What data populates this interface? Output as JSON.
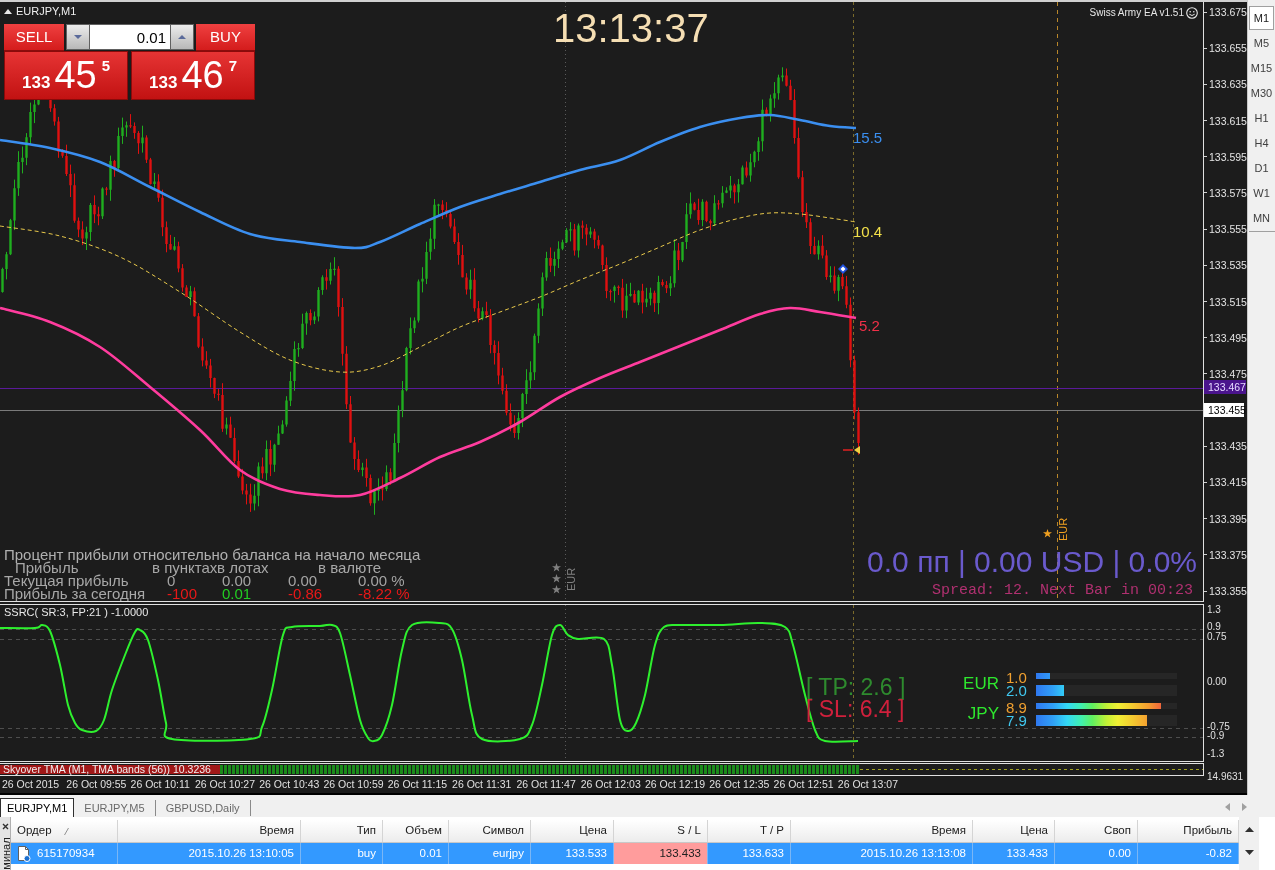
{
  "chart": {
    "title": "EURJPY,M1",
    "trade_panel": {
      "sell_label": "SELL",
      "buy_label": "BUY",
      "lot": "0.01",
      "sell_price": {
        "figure": "133",
        "pips": "45",
        "point": "5"
      },
      "buy_price": {
        "figure": "133",
        "pips": "46",
        "point": "7"
      }
    },
    "clock": "13:13:37",
    "expert_label": "Swiss Army EA v1.51",
    "ma_labels": [
      {
        "text": "15.5",
        "color": "#3b8ff0"
      },
      {
        "text": "10.4",
        "color": "#f2e04a"
      },
      {
        "text": "5.2",
        "color": "#f03048"
      }
    ],
    "profit_report": {
      "title": "Процент прибыли относительно баланса на начало месяца",
      "header": [
        "Прибыль",
        "в пунктах",
        "в лотах",
        "в валюте"
      ],
      "rows": [
        {
          "label": "Текущая прибыль",
          "cells": [
            {
              "text": "0",
              "color": "#a4a4a4"
            },
            {
              "text": "0.00",
              "color": "#a4a4a4"
            },
            {
              "text": "0.00",
              "color": "#a4a4a4"
            },
            {
              "text": "0.00 %",
              "color": "#a4a4a4"
            }
          ]
        },
        {
          "label": "Прибыль за сегодня",
          "cells": [
            {
              "text": "-100",
              "color": "#e81818"
            },
            {
              "text": "0.01",
              "color": "#22cc22"
            },
            {
              "text": "-0.86",
              "color": "#e81818"
            },
            {
              "text": "-8.22 %",
              "color": "#e81818"
            }
          ]
        }
      ]
    },
    "event_markers": [
      {
        "text": "EUR",
        "color": "#808080"
      },
      {
        "text": "EUR",
        "color": "#f0a020"
      }
    ],
    "account_summary": "0.0 пп | 0.00 USD | 0.0%",
    "spread_info": "Spread: 12. Next Bar in 00:23",
    "price_axis": {
      "ticks": [
        {
          "text": "133.675",
          "kind": "tick"
        },
        {
          "text": "133.655",
          "kind": "tick"
        },
        {
          "text": "133.635",
          "kind": "tick"
        },
        {
          "text": "133.615",
          "kind": "tick"
        },
        {
          "text": "133.595",
          "kind": "tick"
        },
        {
          "text": "133.575",
          "kind": "tick"
        },
        {
          "text": "133.555",
          "kind": "tick"
        },
        {
          "text": "133.535",
          "kind": "tick"
        },
        {
          "text": "133.515",
          "kind": "tick"
        },
        {
          "text": "133.495",
          "kind": "tick"
        },
        {
          "text": "133.475",
          "kind": "tick"
        },
        {
          "text": "133.455",
          "kind": "bid"
        },
        {
          "text": "133.435",
          "kind": "tick"
        },
        {
          "text": "133.415",
          "kind": "tick"
        },
        {
          "text": "133.395",
          "kind": "tick"
        },
        {
          "text": "133.375",
          "kind": "tick"
        },
        {
          "text": "133.355",
          "kind": "tick"
        }
      ],
      "ask": "133.467"
    }
  },
  "indicator": {
    "label": "SSRC( SR:3, FP:21 ) -1.0000",
    "take_profit": "[ TP: 2.6 ]",
    "stop_loss": "[ SL: 6.4 ]",
    "strength": [
      {
        "currency": "EUR",
        "values": [
          {
            "text": "1.0",
            "level": 0.1,
            "color": "#f0a030"
          },
          {
            "text": "2.0",
            "level": 0.2,
            "color": "#40c8f0"
          }
        ]
      },
      {
        "currency": "JPY",
        "values": [
          {
            "text": "8.9",
            "level": 0.89,
            "color": "#f0a030"
          },
          {
            "text": "7.9",
            "level": 0.79,
            "color": "#40c8f0"
          }
        ]
      }
    ],
    "axis_ticks": [
      "1.3",
      "0.9",
      "0.75",
      "0.00",
      "-0.75",
      "-0.9",
      "-1.3"
    ]
  },
  "tma_pane": {
    "label": "Skyover TMA (M1, TMA bands (56)) 10.3236",
    "axis_value": "14.9631"
  },
  "time_axis": [
    "26 Oct 2015",
    "26 Oct 09:55",
    "26 Oct 10:11",
    "26 Oct 10:27",
    "26 Oct 10:43",
    "26 Oct 10:59",
    "26 Oct 11:15",
    "26 Oct 11:31",
    "26 Oct 11:47",
    "26 Oct 12:03",
    "26 Oct 12:19",
    "26 Oct 12:35",
    "26 Oct 12:51",
    "26 Oct 13:07"
  ],
  "timeframes": [
    {
      "label": "M1",
      "selected": true
    },
    {
      "label": "M5",
      "selected": false
    },
    {
      "label": "M15",
      "selected": false
    },
    {
      "label": "M30",
      "selected": false
    },
    {
      "label": "H1",
      "selected": false
    },
    {
      "label": "H4",
      "selected": false
    },
    {
      "label": "D1",
      "selected": false
    },
    {
      "label": "W1",
      "selected": false
    },
    {
      "label": "MN",
      "selected": false
    }
  ],
  "chart_tabs": [
    {
      "label": "EURJPY,M1",
      "selected": true
    },
    {
      "label": "EURJPY,M5",
      "selected": false
    },
    {
      "label": "GBPUSD,Daily",
      "selected": false
    }
  ],
  "terminal": {
    "side_label": "минал",
    "columns": [
      "Ордер",
      "Время",
      "Тип",
      "Объем",
      "Символ",
      "Цена",
      "S / L",
      "T / P",
      "Время",
      "Цена",
      "Своп",
      "Прибыль"
    ],
    "rows": [
      {
        "selected": true,
        "cells": [
          {
            "text": "615170934",
            "highlighted": false
          },
          {
            "text": "2015.10.26 13:10:05",
            "highlighted": false
          },
          {
            "text": "buy",
            "highlighted": false
          },
          {
            "text": "0.01",
            "highlighted": false
          },
          {
            "text": "eurjpy",
            "highlighted": false
          },
          {
            "text": "133.533",
            "highlighted": false
          },
          {
            "text": "133.433",
            "highlighted": true
          },
          {
            "text": "133.633",
            "highlighted": false
          },
          {
            "text": "2015.10.26 13:13:08",
            "highlighted": false
          },
          {
            "text": "133.433",
            "highlighted": false
          },
          {
            "text": "0.00",
            "highlighted": false
          },
          {
            "text": "-0.82",
            "highlighted": false
          }
        ]
      }
    ]
  }
}
